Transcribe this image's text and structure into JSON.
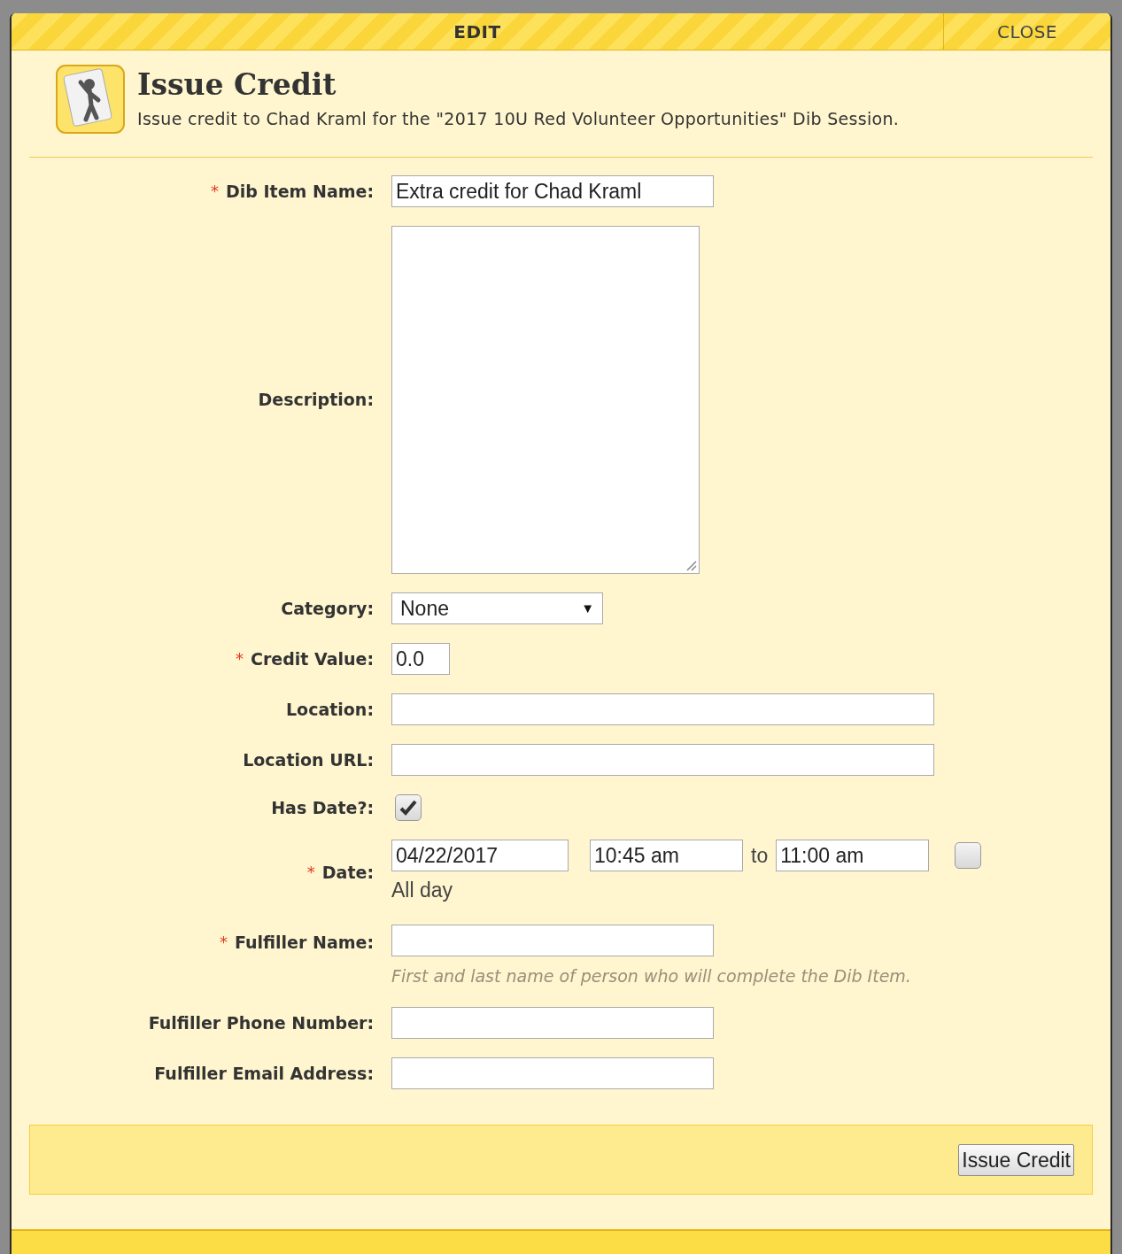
{
  "header": {
    "title": "EDIT",
    "close": "CLOSE"
  },
  "dialog": {
    "title": "Issue Credit",
    "subtitle": "Issue credit to Chad Kraml for the \"2017 10U Red Volunteer Opportunities\" Dib Session."
  },
  "fields": [
    {
      "kind": "text",
      "label": "Dib Item Name:",
      "required": true,
      "value": "Extra credit for Chad Kraml"
    },
    {
      "kind": "textarea",
      "label": "Description:",
      "required": false
    },
    {
      "kind": "select",
      "label": "Category:",
      "required": false,
      "value": "None",
      "arrow": "▼"
    },
    {
      "kind": "number",
      "label": "Credit Value:",
      "required": true,
      "value": "0.0"
    },
    {
      "kind": "long_text",
      "label": "Location:",
      "required": false
    },
    {
      "kind": "long_text",
      "label": "Location URL:",
      "required": false
    },
    {
      "kind": "checkbox",
      "label": "Has Date?:",
      "required": false,
      "checked": true
    },
    {
      "kind": "date",
      "label": "Date:",
      "required": true,
      "date": "04/22/2017",
      "start": "10:45 am",
      "to": "to",
      "end": "11:00 am",
      "all_day": {
        "label": "All day",
        "checked": false
      }
    },
    {
      "kind": "text",
      "label": "Fulfiller Name:",
      "required": true,
      "hint": "First and last name of person who will complete the Dib Item."
    },
    {
      "kind": "text",
      "label": "Fulfiller Phone Number:",
      "required": false
    },
    {
      "kind": "text",
      "label": "Fulfiller Email Address:",
      "required": false
    }
  ],
  "footer": {
    "button": "Issue Credit"
  },
  "required_mark": "*"
}
